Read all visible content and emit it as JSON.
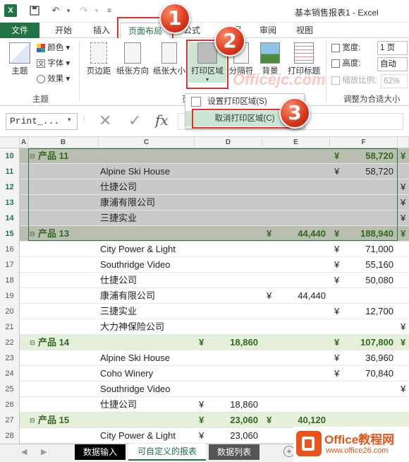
{
  "titlebar": {
    "title": "基本销售报表1 - Excel"
  },
  "ribbon_tabs": [
    "文件",
    "开始",
    "插入",
    "页面布局",
    "公式",
    "数据",
    "审阅",
    "视图"
  ],
  "theme_group": {
    "themes": "主题",
    "colors": "颜色",
    "fonts": "字体",
    "effects": "效果",
    "label": "主题"
  },
  "page_setup": {
    "margins": "页边距",
    "orientation": "纸张方向",
    "size": "纸张大小",
    "print_area": "打印区域",
    "breaks": "分隔符",
    "background": "背景",
    "print_titles": "打印标题",
    "label": "页"
  },
  "scale_group": {
    "width_label": "宽度:",
    "width_value": "1 页",
    "height_label": "高度:",
    "height_value": "自动",
    "scale_label": "缩放比例:",
    "scale_value": "62%",
    "label": "调整为合适大小"
  },
  "dropdown": {
    "set_print_area": "设置打印区域(S)",
    "clear_print_area": "取消打印区域(C)"
  },
  "formula_bar": {
    "name_box": "Print_...",
    "fx": "fx"
  },
  "callouts": [
    "1",
    "2",
    "3"
  ],
  "watermark": {
    "main": "Officejc.com"
  },
  "logo": {
    "brand": "Office教程网",
    "url": "www.office26.com"
  },
  "columns": [
    "A",
    "B",
    "C",
    "D",
    "E",
    "F"
  ],
  "currency": "¥",
  "rows": [
    {
      "n": "10",
      "b": "产品 11",
      "c": "",
      "d": "",
      "e": "",
      "f": "58,720",
      "type": "product",
      "sel": true,
      "f_sym": true,
      "extra": "¥"
    },
    {
      "n": "11",
      "b": "",
      "c": "Alpine Ski House",
      "d": "",
      "e": "",
      "f": "58,720",
      "type": "item",
      "sel": true,
      "f_sym": true
    },
    {
      "n": "12",
      "b": "",
      "c": "仕捷公司",
      "d": "",
      "e": "",
      "f": "",
      "type": "item",
      "sel": true,
      "extra": "¥"
    },
    {
      "n": "13",
      "b": "",
      "c": "康浦有限公司",
      "d": "",
      "e": "",
      "f": "",
      "type": "item",
      "sel": true,
      "extra": "¥"
    },
    {
      "n": "14",
      "b": "",
      "c": "三捷实业",
      "d": "",
      "e": "",
      "f": "",
      "type": "item",
      "sel": true,
      "extra": "¥"
    },
    {
      "n": "15",
      "b": "产品 13",
      "c": "",
      "d": "",
      "e": "44,440",
      "f": "188,940",
      "type": "product",
      "sel": true,
      "e_sym": true,
      "f_sym": true,
      "extra": "¥"
    },
    {
      "n": "16",
      "b": "",
      "c": "City Power & Light",
      "d": "",
      "e": "",
      "f": "71,000",
      "type": "item",
      "f_sym": true
    },
    {
      "n": "17",
      "b": "",
      "c": "Southridge Video",
      "d": "",
      "e": "",
      "f": "55,160",
      "type": "item",
      "f_sym": true
    },
    {
      "n": "18",
      "b": "",
      "c": "仕捷公司",
      "d": "",
      "e": "",
      "f": "50,080",
      "type": "item",
      "f_sym": true
    },
    {
      "n": "19",
      "b": "",
      "c": "康浦有限公司",
      "d": "",
      "e": "44,440",
      "f": "",
      "type": "item",
      "e_sym": true
    },
    {
      "n": "20",
      "b": "",
      "c": "三捷实业",
      "d": "",
      "e": "",
      "f": "12,700",
      "type": "item",
      "f_sym": true
    },
    {
      "n": "21",
      "b": "",
      "c": "大力神保险公司",
      "d": "",
      "e": "",
      "f": "",
      "type": "item",
      "extra": "¥"
    },
    {
      "n": "22",
      "b": "产品 14",
      "c": "",
      "d": "18,860",
      "e": "",
      "f": "107,800",
      "type": "product",
      "d_sym": true,
      "f_sym": true,
      "extra": "¥"
    },
    {
      "n": "23",
      "b": "",
      "c": "Alpine Ski House",
      "d": "",
      "e": "",
      "f": "36,960",
      "type": "item",
      "f_sym": true
    },
    {
      "n": "24",
      "b": "",
      "c": "Coho Winery",
      "d": "",
      "e": "",
      "f": "70,840",
      "type": "item",
      "f_sym": true
    },
    {
      "n": "25",
      "b": "",
      "c": "Southridge Video",
      "d": "",
      "e": "",
      "f": "",
      "type": "item",
      "extra": "¥"
    },
    {
      "n": "26",
      "b": "",
      "c": "仕捷公司",
      "d": "18,860",
      "e": "",
      "f": "",
      "type": "item",
      "d_sym": true
    },
    {
      "n": "27",
      "b": "产品 15",
      "c": "",
      "d": "23,060",
      "e": "40,120",
      "f": "",
      "type": "product",
      "d_sym": true,
      "e_sym": true
    },
    {
      "n": "28",
      "b": "",
      "c": "City Power & Light",
      "d": "23,060",
      "e": "",
      "f": "",
      "type": "item",
      "d_sym": true
    }
  ],
  "sheet_tabs": [
    "数据输入",
    "可自定义的报表",
    "数据列表"
  ],
  "colors": {
    "excel_green": "#217346",
    "product_band": "#e6efda",
    "selection": "#c9c9c9",
    "callout_red": "#e0322a"
  }
}
